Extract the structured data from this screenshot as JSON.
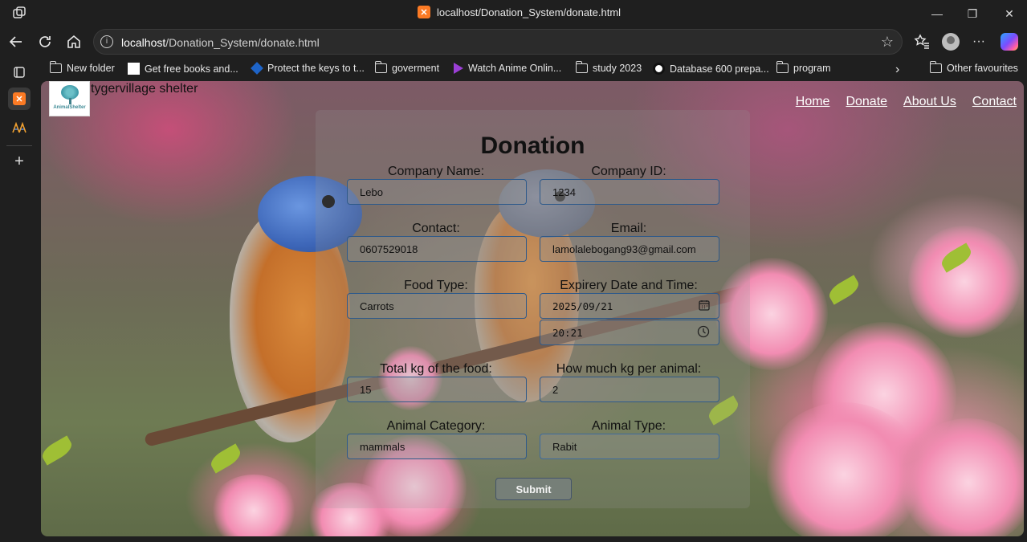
{
  "browser": {
    "tab_title": "localhost/Donation_System/donate.html",
    "favicon": "xampp-icon",
    "url_host": "localhost",
    "url_path": "/Donation_System/donate.html"
  },
  "bookmarks": [
    {
      "label": "New folder",
      "icon": "folder-icon"
    },
    {
      "label": "Get free books and...",
      "icon": "page-icon"
    },
    {
      "label": "Protect the keys to t...",
      "icon": "shield-icon"
    },
    {
      "label": "goverment",
      "icon": "folder-icon"
    },
    {
      "label": "Watch Anime Onlin...",
      "icon": "play-icon"
    },
    {
      "label": "study 2023",
      "icon": "folder-icon"
    },
    {
      "label": "Database 600 prepa...",
      "icon": "site-icon"
    },
    {
      "label": "program",
      "icon": "folder-icon"
    },
    {
      "label": "Other favourites",
      "icon": "folder-icon"
    }
  ],
  "site": {
    "name": "tygervillage shelter",
    "logo_text": "AnimalShelter",
    "nav": [
      "Home",
      "Donate",
      "About Us",
      "Contact"
    ]
  },
  "form": {
    "title": "Donation",
    "company_name_label": "Company Name:",
    "company_name": "Lebo",
    "company_id_label": "Company ID:",
    "company_id": "1234",
    "contact_label": "Contact:",
    "contact": "0607529018",
    "email_label": "Email:",
    "email": "lamolalebogang93@gmail.com",
    "food_type_label": "Food Type:",
    "food_type": "Carrots",
    "expiry_label": "Expirery Date and Time:",
    "expiry_date": "2025/09/21",
    "expiry_time": "20:21",
    "total_kg_label": "Total kg of the food:",
    "total_kg": "15",
    "kg_per_animal_label": "How much kg per animal:",
    "kg_per_animal": "2",
    "animal_category_label": "Animal Category:",
    "animal_category": "mammals",
    "animal_type_label": "Animal Type:",
    "animal_type": "Rabit",
    "submit_label": "Submit"
  }
}
